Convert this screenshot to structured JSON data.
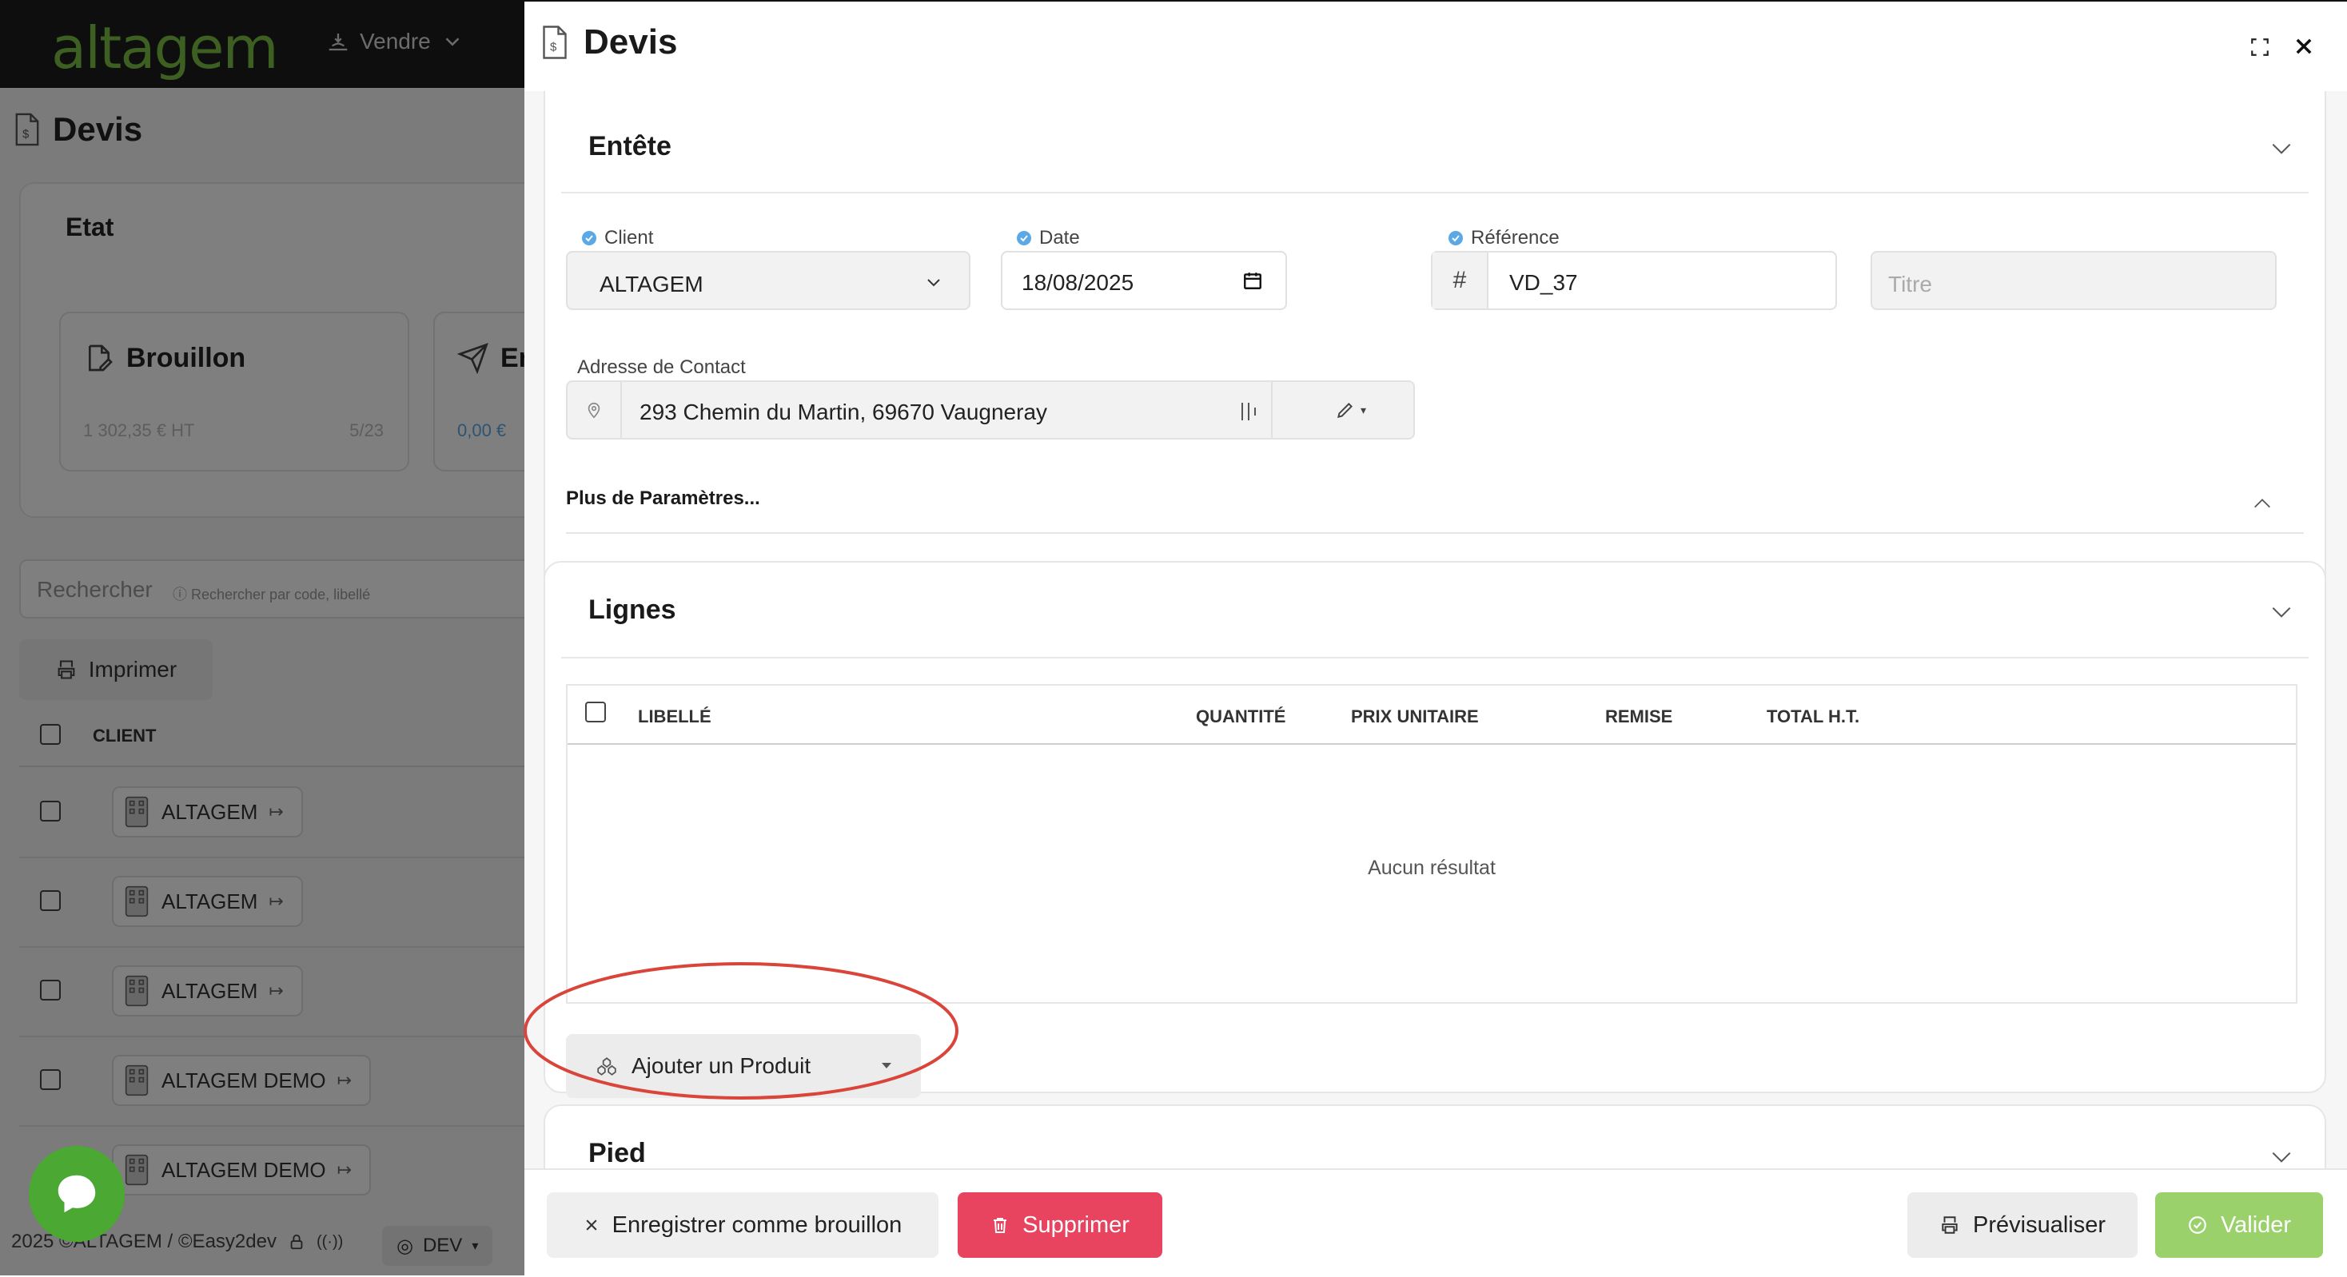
{
  "background": {
    "logo": "altagem",
    "menu_sell": "Vendre",
    "page_title": "Devis",
    "etat_label": "Etat",
    "states": [
      {
        "name": "Brouillon",
        "amount": "1 302,35 € HT",
        "count": "5/23"
      },
      {
        "name": "En",
        "amount": "0,00 €",
        "count": ""
      }
    ],
    "search_placeholder": "Rechercher",
    "search_hint": "Rechercher par code, libellé",
    "print_label": "Imprimer",
    "column_client": "CLIENT",
    "rows": [
      "ALTAGEM",
      "ALTAGEM",
      "ALTAGEM",
      "ALTAGEM DEMO",
      "ALTAGEM DEMO"
    ],
    "footer_text": "2025 ©ALTAGEM / ©Easy2dev",
    "env_label": "DEV"
  },
  "drawer": {
    "title": "Devis",
    "entete": {
      "title": "Entête",
      "client_label": "Client",
      "client_value": "ALTAGEM",
      "date_label": "Date",
      "date_value": "18/08/2025",
      "reference_label": "Référence",
      "reference_prefix": "#",
      "reference_value": "VD_37",
      "titre_placeholder": "Titre",
      "address_label": "Adresse de Contact",
      "address_value": "293 Chemin du Martin, 69670 Vaugneray",
      "more_params": "Plus de Paramètres..."
    },
    "lignes": {
      "title": "Lignes",
      "columns": [
        "LIBELLÉ",
        "QUANTITÉ",
        "PRIX UNITAIRE",
        "REMISE",
        "TOTAL H.T."
      ],
      "empty": "Aucun résultat",
      "add_product": "Ajouter un Produit"
    },
    "pied": {
      "title": "Pied"
    },
    "footer": {
      "draft": "Enregistrer comme brouillon",
      "delete": "Supprimer",
      "preview": "Prévisualiser",
      "validate": "Valider"
    }
  },
  "colors": {
    "brand_green": "#7bbf45",
    "delete_red": "#e8435f",
    "validate_green": "#9bd16a",
    "highlight": "#d9453a",
    "info_blue": "#5aa8e6"
  }
}
